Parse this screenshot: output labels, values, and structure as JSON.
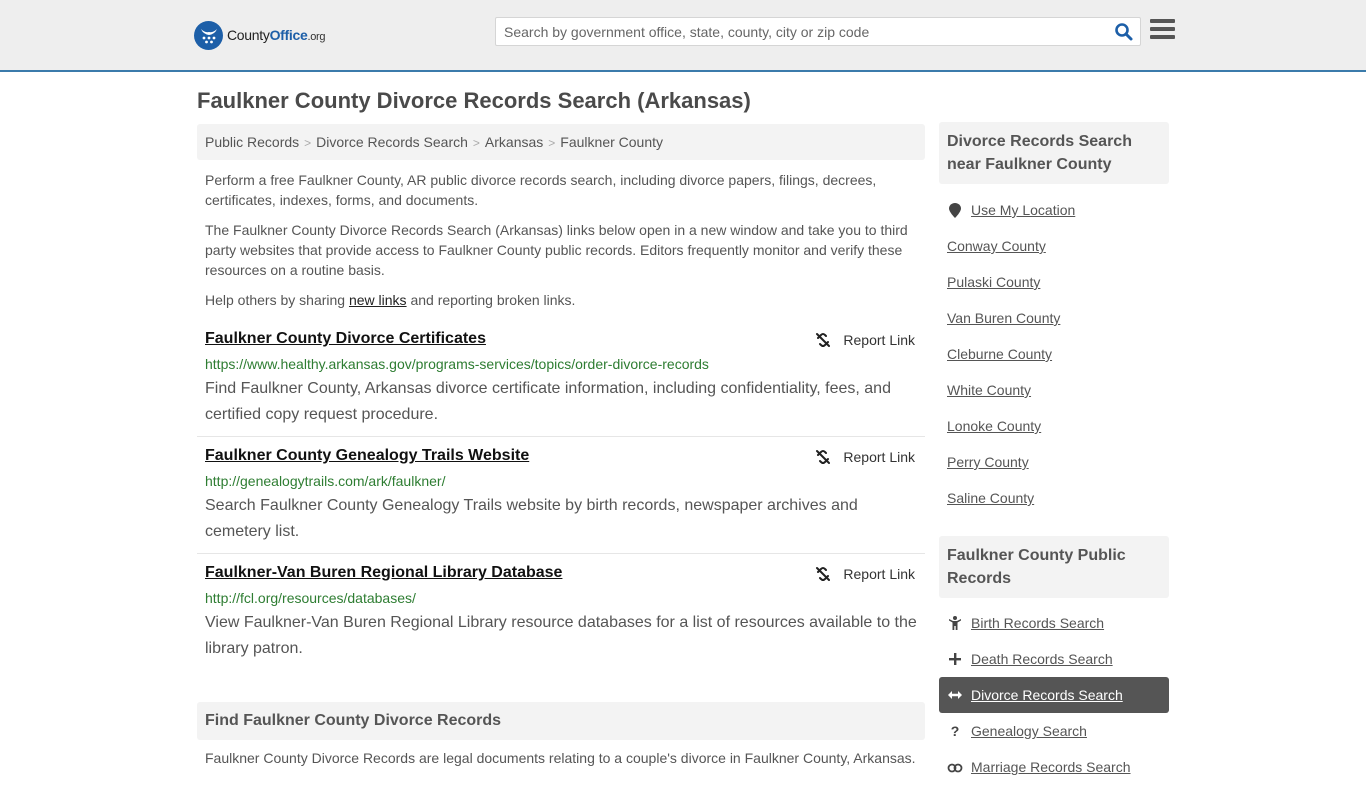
{
  "header": {
    "logo": {
      "county": "County",
      "office": "Office",
      "org": ".org"
    },
    "search_placeholder": "Search by government office, state, county, city or zip code",
    "accent_color": "#3b7bab"
  },
  "page_title": "Faulkner County Divorce Records Search (Arkansas)",
  "breadcrumb": [
    "Public Records",
    "Divorce Records Search",
    "Arkansas",
    "Faulkner County"
  ],
  "intro": {
    "p1": "Perform a free Faulkner County, AR public divorce records search, including divorce papers, filings, decrees, certificates, indexes, forms, and documents.",
    "p2": "The Faulkner County Divorce Records Search (Arkansas) links below open in a new window and take you to third party websites that provide access to Faulkner County public records. Editors frequently monitor and verify these resources on a routine basis.",
    "p3_before": "Help others by sharing ",
    "p3_link": "new links",
    "p3_after": " and reporting broken links."
  },
  "report_label": "Report Link",
  "results": [
    {
      "title": "Faulkner County Divorce Certificates",
      "url": "https://www.healthy.arkansas.gov/programs-services/topics/order-divorce-records",
      "description": "Find Faulkner County, Arkansas divorce certificate information, including confidentiality, fees, and certified copy request procedure."
    },
    {
      "title": "Faulkner County Genealogy Trails Website",
      "url": "http://genealogytrails.com/ark/faulkner/",
      "description": "Search Faulkner County Genealogy Trails website by birth records, newspaper archives and cemetery list."
    },
    {
      "title": "Faulkner-Van Buren Regional Library Database",
      "url": "http://fcl.org/resources/databases/",
      "description": "View Faulkner-Van Buren Regional Library resource databases for a list of resources available to the library patron."
    }
  ],
  "find_section": {
    "title": "Find Faulkner County Divorce Records",
    "text": "Faulkner County Divorce Records are legal documents relating to a couple's divorce in Faulkner County, Arkansas."
  },
  "sidebar": {
    "nearby_title": "Divorce Records Search near Faulkner County",
    "use_location": "Use My Location",
    "nearby": [
      "Conway County",
      "Pulaski County",
      "Van Buren County",
      "Cleburne County",
      "White County",
      "Lonoke County",
      "Perry County",
      "Saline County"
    ],
    "public_title": "Faulkner County Public Records",
    "public_records": [
      {
        "label": "Birth Records Search",
        "icon": "child-icon",
        "glyph": "Ὣ8",
        "active": false
      },
      {
        "label": "Death Records Search",
        "icon": "plus-icon",
        "active": false
      },
      {
        "label": "Divorce Records Search",
        "icon": "arrows-horizontal-icon",
        "active": true
      },
      {
        "label": "Genealogy Search",
        "icon": "question-icon",
        "active": false
      },
      {
        "label": "Marriage Records Search",
        "icon": "rings-icon",
        "active": false
      }
    ]
  }
}
